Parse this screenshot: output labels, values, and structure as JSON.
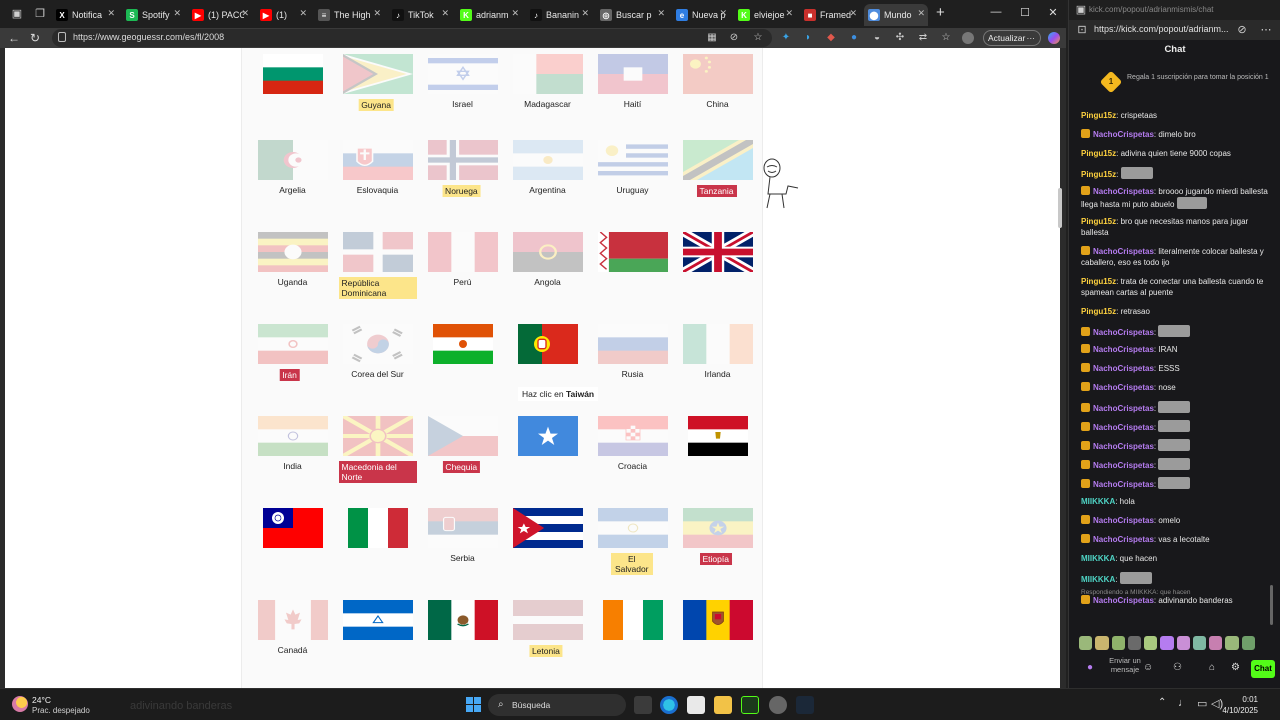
{
  "tabs": [
    {
      "label": "Notifica",
      "favicon": "x-icon",
      "color": "#000000",
      "glyph": "X"
    },
    {
      "label": "Spotify",
      "favicon": "spotify-icon",
      "color": "#1db954",
      "glyph": "S"
    },
    {
      "label": "(1) PACO",
      "favicon": "youtube-icon",
      "color": "#ff0000",
      "glyph": "▶"
    },
    {
      "label": "(1)",
      "favicon": "youtube-icon",
      "color": "#ff0000",
      "glyph": "▶"
    },
    {
      "label": "The High",
      "favicon": "generic-icon",
      "color": "#555555",
      "glyph": "≡"
    },
    {
      "label": "TikTok",
      "favicon": "tiktok-icon",
      "color": "#111111",
      "glyph": "♪"
    },
    {
      "label": "adrianm",
      "favicon": "kick-icon",
      "color": "#53fc18",
      "glyph": "K"
    },
    {
      "label": "Bananin",
      "favicon": "tiktok-icon",
      "color": "#111111",
      "glyph": "♪"
    },
    {
      "label": "Buscar p",
      "favicon": "globe-icon",
      "color": "#666666",
      "glyph": "◎"
    },
    {
      "label": "Nueva p",
      "favicon": "edge-icon",
      "color": "#2f7de1",
      "glyph": "e"
    },
    {
      "label": "elviejoe",
      "favicon": "kick-icon",
      "color": "#53fc18",
      "glyph": "K"
    },
    {
      "label": "Framed",
      "favicon": "framed-icon",
      "color": "#c9302c",
      "glyph": "■"
    },
    {
      "label": "Mundo",
      "favicon": "geoguessr-icon",
      "color": "#4f8dde",
      "glyph": "⬤",
      "active": true
    }
  ],
  "address": {
    "url": "https://www.geoguessr.com/es/fl/2008",
    "update_label": "Actualizar"
  },
  "flags": [
    {
      "name": "Bulgaria",
      "label": "",
      "faded": false,
      "hl": ""
    },
    {
      "name": "Guyana",
      "label": "Guyana",
      "faded": true,
      "hl": "y"
    },
    {
      "name": "Israel",
      "label": "Israel",
      "faded": true,
      "hl": ""
    },
    {
      "name": "Madagascar",
      "label": "Madagascar",
      "faded": true,
      "hl": ""
    },
    {
      "name": "Haiti",
      "label": "Haití",
      "faded": true,
      "hl": ""
    },
    {
      "name": "China",
      "label": "China",
      "faded": true,
      "hl": ""
    },
    {
      "name": "Algeria",
      "label": "Argelia",
      "faded": true,
      "hl": ""
    },
    {
      "name": "Slovakia",
      "label": "Eslovaquia",
      "faded": true,
      "hl": ""
    },
    {
      "name": "Norway",
      "label": "Noruega",
      "faded": true,
      "hl": "y"
    },
    {
      "name": "Argentina",
      "label": "Argentina",
      "faded": true,
      "hl": ""
    },
    {
      "name": "Uruguay",
      "label": "Uruguay",
      "faded": true,
      "hl": ""
    },
    {
      "name": "Tanzania",
      "label": "Tanzania",
      "faded": true,
      "hl": "r"
    },
    {
      "name": "Uganda",
      "label": "Uganda",
      "faded": true,
      "hl": ""
    },
    {
      "name": "DominicanRepublic",
      "label": "República Dominicana",
      "faded": true,
      "hl": "y"
    },
    {
      "name": "Peru",
      "label": "Perú",
      "faded": true,
      "hl": ""
    },
    {
      "name": "Angola",
      "label": "Angola",
      "faded": true,
      "hl": ""
    },
    {
      "name": "Belarus",
      "label": "",
      "faded": false,
      "hl": ""
    },
    {
      "name": "UK",
      "label": "",
      "faded": false,
      "hl": ""
    },
    {
      "name": "Iran",
      "label": "Irán",
      "faded": true,
      "hl": "r"
    },
    {
      "name": "SouthKorea",
      "label": "Corea del Sur",
      "faded": true,
      "hl": ""
    },
    {
      "name": "Niger",
      "label": "",
      "faded": false,
      "hl": ""
    },
    {
      "name": "Portugal",
      "label": "",
      "faded": false,
      "hl": ""
    },
    {
      "name": "Russia",
      "label": "Rusia",
      "faded": true,
      "hl": ""
    },
    {
      "name": "Ireland",
      "label": "Irlanda",
      "faded": true,
      "hl": ""
    },
    {
      "name": "India",
      "label": "India",
      "faded": true,
      "hl": ""
    },
    {
      "name": "NorthMacedonia",
      "label": "Macedonia del Norte",
      "faded": true,
      "hl": "r"
    },
    {
      "name": "Czechia",
      "label": "Chequia",
      "faded": true,
      "hl": "r"
    },
    {
      "name": "Somalia",
      "label": "",
      "faded": false,
      "hl": ""
    },
    {
      "name": "Croatia",
      "label": "Croacia",
      "faded": true,
      "hl": ""
    },
    {
      "name": "Egypt",
      "label": "",
      "faded": false,
      "hl": ""
    },
    {
      "name": "Taiwan",
      "label": "",
      "faded": false,
      "hl": ""
    },
    {
      "name": "Italy",
      "label": "",
      "faded": false,
      "hl": ""
    },
    {
      "name": "Serbia",
      "label": "Serbia",
      "faded": true,
      "hl": ""
    },
    {
      "name": "Cuba",
      "label": "",
      "faded": false,
      "hl": ""
    },
    {
      "name": "ElSalvador",
      "label": "El Salvador",
      "faded": true,
      "hl": "y"
    },
    {
      "name": "Ethiopia",
      "label": "Etiopía",
      "faded": true,
      "hl": "r"
    },
    {
      "name": "Canada",
      "label": "Canadá",
      "faded": true,
      "hl": ""
    },
    {
      "name": "Nicaragua",
      "label": "",
      "faded": false,
      "hl": ""
    },
    {
      "name": "Mexico",
      "label": "",
      "faded": false,
      "hl": ""
    },
    {
      "name": "Latvia",
      "label": "Letonia",
      "faded": true,
      "hl": "y"
    },
    {
      "name": "IvoryCoast",
      "label": "",
      "faded": false,
      "hl": ""
    },
    {
      "name": "Moldova",
      "label": "",
      "faded": false,
      "hl": ""
    }
  ],
  "tooltip": {
    "prefix": "Haz clic en ",
    "target": "Taiwán"
  },
  "chat": {
    "window_title": "kick.com/popout/adrianmismis/chat",
    "url": "https://kick.com/popout/adrianm...",
    "title": "Chat",
    "pinned_badge": "1",
    "pinned_text": "Regala 1 suscripción para tomar la posición 1",
    "reply_context": "Respondiendo a MIIKKKA: que hacen",
    "input_placeholder": "Enviar un mensaje",
    "send_label": "Chat",
    "messages": [
      {
        "user": "Pingu15z",
        "cls": "pingu",
        "sub": false,
        "text": "crispetaas",
        "emote": 0
      },
      {
        "user": "NachoCrispetas",
        "cls": "nacho",
        "sub": true,
        "text": "dimelo bro",
        "emote": 0
      },
      {
        "user": "Pingu15z",
        "cls": "pingu",
        "sub": false,
        "text": "adivina quien tiene 9000 copas",
        "emote": 0
      },
      {
        "user": "Pingu15z",
        "cls": "pingu",
        "sub": false,
        "text": "",
        "emote": 1
      },
      {
        "user": "NachoCrispetas",
        "cls": "nacho",
        "sub": true,
        "text": "broooo jugando mierdi ballesta llega hasta mi puto abuelo",
        "emote": 1
      },
      {
        "user": "Pingu15z",
        "cls": "pingu",
        "sub": false,
        "text": "bro que necesitas manos para jugar ballesta",
        "emote": 0
      },
      {
        "user": "NachoCrispetas",
        "cls": "nacho",
        "sub": true,
        "text": "literalmente colocar ballesta y caballero, eso es todo ijo",
        "emote": 0
      },
      {
        "user": "Pingu15z",
        "cls": "pingu",
        "sub": false,
        "text": "trata de conectar una ballesta cuando te spamean cartas al puente",
        "emote": 0
      },
      {
        "user": "Pingu15z",
        "cls": "pingu",
        "sub": false,
        "text": "retrasao",
        "emote": 0
      },
      {
        "user": "NachoCrispetas",
        "cls": "nacho",
        "sub": true,
        "text": "",
        "emote": 1
      },
      {
        "user": "NachoCrispetas",
        "cls": "nacho",
        "sub": true,
        "text": "IRAN",
        "emote": 0
      },
      {
        "user": "NachoCrispetas",
        "cls": "nacho",
        "sub": true,
        "text": "ESSS",
        "emote": 0
      },
      {
        "user": "NachoCrispetas",
        "cls": "nacho",
        "sub": true,
        "text": "nose",
        "emote": 0
      },
      {
        "user": "NachoCrispetas",
        "cls": "nacho",
        "sub": true,
        "text": "",
        "emote": 1
      },
      {
        "user": "NachoCrispetas",
        "cls": "nacho",
        "sub": true,
        "text": "",
        "emote": 1
      },
      {
        "user": "NachoCrispetas",
        "cls": "nacho",
        "sub": true,
        "text": "",
        "emote": 1
      },
      {
        "user": "NachoCrispetas",
        "cls": "nacho",
        "sub": true,
        "text": "",
        "emote": 1
      },
      {
        "user": "NachoCrispetas",
        "cls": "nacho",
        "sub": true,
        "text": "",
        "emote": 1
      },
      {
        "user": "MIIKKKA",
        "cls": "miik",
        "sub": false,
        "text": "hola",
        "emote": 0
      },
      {
        "user": "NachoCrispetas",
        "cls": "nacho",
        "sub": true,
        "text": "omelo",
        "emote": 0
      },
      {
        "user": "NachoCrispetas",
        "cls": "nacho",
        "sub": true,
        "text": "vas a lecotalte",
        "emote": 0
      },
      {
        "user": "MIIKKKA",
        "cls": "miik",
        "sub": false,
        "text": "que hacen",
        "emote": 0
      },
      {
        "user": "MIIKKKA",
        "cls": "miik",
        "sub": false,
        "text": "",
        "emote": 1
      },
      {
        "user": "NachoCrispetas",
        "cls": "nacho",
        "sub": true,
        "text": "adivinando banderas",
        "emote": 0
      }
    ]
  },
  "taskbar": {
    "temp": "24°C",
    "weather": "Prac. despejado",
    "ghost_text": "adivinando banderas",
    "search_placeholder": "Búsqueda",
    "time": "0:01",
    "date": "4/10/2025"
  },
  "colors": {
    "highlight_yellow": "#fce58a",
    "highlight_red": "#c9354a",
    "kick_green": "#53fc18"
  }
}
